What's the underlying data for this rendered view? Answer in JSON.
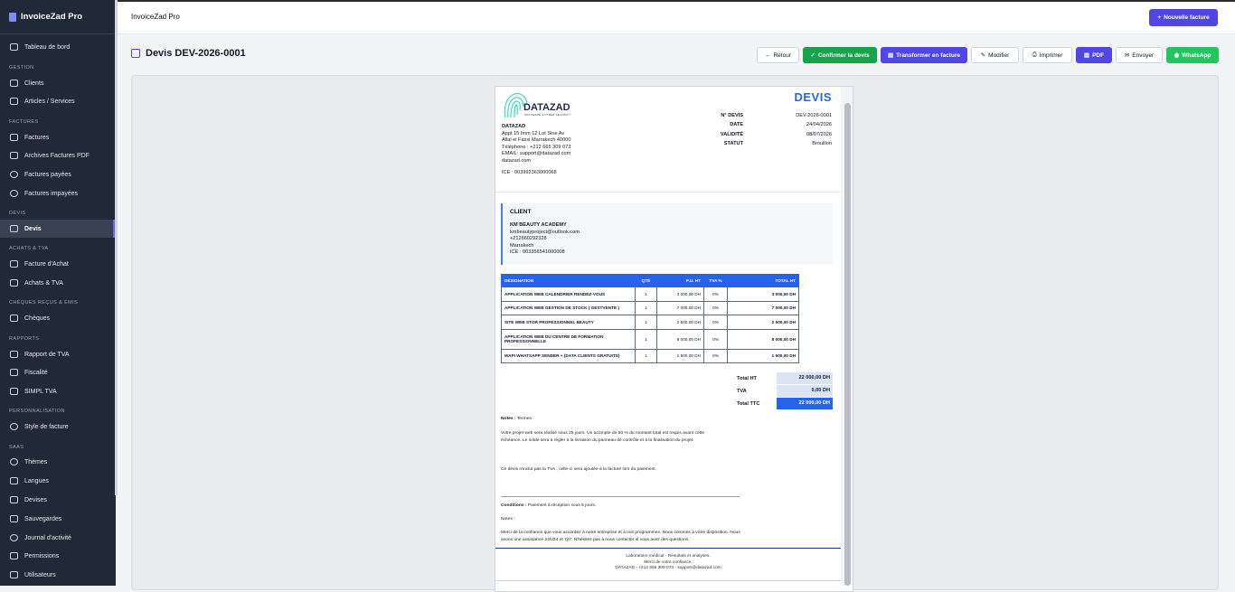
{
  "app": {
    "brand": "InvoiceZad Pro",
    "topbar_title": "InvoiceZad Pro",
    "new_invoice": "Nouvelle facture",
    "accent": "#4f46e5"
  },
  "sidebar": {
    "dashboard": "Tableau de bord",
    "sections": {
      "gestion": "GESTION",
      "factures": "FACTURES",
      "devis": "DEVIS",
      "achats": "ACHATS & TVA",
      "cheques": "CHÈQUES REÇUS & ÉMIS",
      "rapports": "RAPPORTS",
      "perso": "PERSONNALISATION",
      "saas": "SAAS"
    },
    "items": {
      "clients": "Clients",
      "articles": "Articles / Services",
      "factures": "Factures",
      "archives": "Archives Factures PDF",
      "payees": "Factures payées",
      "impayees": "Factures impayées",
      "devis": "Devis",
      "facture_achat": "Facture d'Achat",
      "achats_tva": "Achats & TVA",
      "cheques": "Chèques",
      "rapport_tva": "Rapport de TVA",
      "fiscalite": "Fiscalité",
      "simpl": "SIMPL TVA",
      "style": "Style de facture",
      "themes": "Thèmes",
      "langues": "Langues",
      "devises": "Devises",
      "sauvegardes": "Sauvegardes",
      "journal": "Journal d'activité",
      "permissions": "Permissions",
      "utilisateurs": "Utilisateurs"
    }
  },
  "page": {
    "title": "Devis DEV-2026-0001",
    "actions": {
      "retour": "Retour",
      "confirmer": "Confirmer la devis",
      "transformer": "Transformer en facture",
      "modifier": "Modifier",
      "imprimer": "Imprimer",
      "pdf": "PDF",
      "envoyer": "Envoyer",
      "whatsapp": "WhatsApp"
    }
  },
  "doc": {
    "logo_text": "DATAZAD",
    "logo_sub": "SOFTWARE & CYBER SECURITY",
    "heading": "DEVIS",
    "company": {
      "name": "DATAZAD",
      "addr1": "Appt 15 Imm 12 Lot Sine Av",
      "addr2": "Allal el Fassi Marrakech 40000",
      "phone": "Téléphone : +212 665 309 073",
      "email": "EMAIL: support@datazad.com",
      "site": "datazad.com",
      "ice": "ICE : 003992363000068"
    },
    "meta": [
      {
        "k": "N° DEVIS",
        "v": "DEV-2026-0001"
      },
      {
        "k": "DATE",
        "v": "24/04/2026"
      },
      {
        "k": "VALIDITÉ",
        "v": "08/07/2026"
      },
      {
        "k": "STATUT",
        "v": "Brouillon"
      }
    ],
    "client": {
      "label": "CLIENT",
      "name": "KM BEAUTY ACADEMY",
      "email": "kmbeautyproject@outlook.com",
      "phone": "+212660292328",
      "city": "Marrakech",
      "ice": "ICE : 003356541000008"
    },
    "table": {
      "headers": [
        "DÉSIGNATION",
        "QTÉ",
        "P.U. HT",
        "TVA %",
        "TOTAL HT"
      ],
      "rows": [
        [
          "APPLICATION WEB CALENDRIER RENDEZ-VOUS",
          "1",
          "3 000,00 DH",
          "0%",
          "3 000,00 DH"
        ],
        [
          "APPLICATION WEB GESTION DE STOCK ( GESTVENTE )",
          "1",
          "7 000,00 DH",
          "0%",
          "7 000,00 DH"
        ],
        [
          "SITE WEB STOR PROFESSIONNEL BEAUTY",
          "1",
          "2 500,00 DH",
          "0%",
          "2 500,00 DH"
        ],
        [
          "APPLICATION WEB DU CENTRE DE FORMATION PROFESSIONNELLE",
          "1",
          "8 000,00 DH",
          "0%",
          "8 000,00 DH"
        ],
        [
          "WAPI WHATSAPP SENDER + (DATA CLIENTS GRATUITS)",
          "1",
          "1 500,00 DH",
          "0%",
          "1 500,00 DH"
        ]
      ]
    },
    "totals": [
      {
        "k": "Total HT",
        "v": "22 000,00 DH"
      },
      {
        "k": "TVA",
        "v": "0,00 DH"
      },
      {
        "k": "Total TTC",
        "v": "22 000,00 DH"
      }
    ],
    "notes": {
      "label": "Notes :",
      "label_value": "Termes :",
      "p1": "Votre projet web sera réalisé sous 25 jours. Un acompte de 50 % du montant total est requis avant cette échéance. Le solde sera à régler à la livraison du panneau de contrôle et à la finalisation du projet.",
      "p2": "Ce devis n'inclut pas la TVA ; celle-ci sera ajoutée à la facture lors du paiement.",
      "cond_label": "Conditions :",
      "cond": "Paiement à réception sous 5 jours.",
      "notes2": "Notes :",
      "thanks": "Merci de la confiance que vous accordez à notre entreprise et à nos programmes. Nous sommes à votre disposition. Nous avons une assistance 24h/24 et 7j/7. N'hésitez pas à nous contacter si vous avez des questions."
    },
    "footer": {
      "l1": "Laboratoire médical - Résultats et analyses.",
      "l2": "Merci de votre confiance.",
      "l3": "DATAZAD - +212 665 309 073 - support@datazad.com"
    }
  }
}
